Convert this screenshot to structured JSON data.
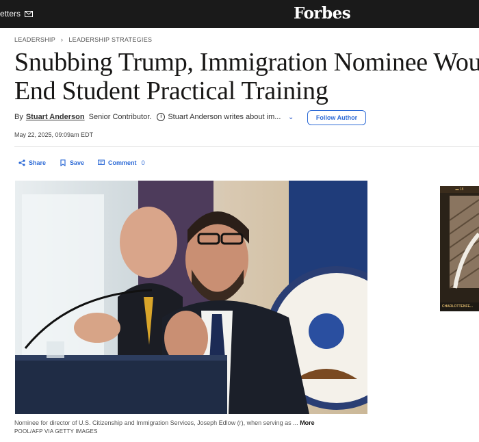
{
  "topbar": {
    "newsletters_label": "etters",
    "logo": "Forbes"
  },
  "breadcrumb": {
    "section": "LEADERSHIP",
    "subsection": "LEADERSHIP STRATEGIES"
  },
  "article": {
    "headline_line1": "Snubbing Trump, Immigration Nominee Would",
    "headline_line2": "End Student Practical Training",
    "by_label": "By",
    "author": "Stuart Anderson",
    "role": "Senior Contributor.",
    "about": "Stuart Anderson writes about im...",
    "follow_label": "Follow Author",
    "date": "May 22, 2025, 09:09am EDT"
  },
  "actions": {
    "share_label": "Share",
    "save_label": "Save",
    "comment_label": "Comment",
    "comment_count": "0"
  },
  "photo": {
    "caption": "Nominee for director of U.S. Citizenship and Immigration Services, Joseph Edlow (r), when serving as ...",
    "more_label": "More",
    "credit": "POOL/AFP VIA GETTY IMAGES"
  },
  "ad": {
    "top_text": "▬ 18",
    "brand_text": "CHARLOTTENFE..."
  }
}
